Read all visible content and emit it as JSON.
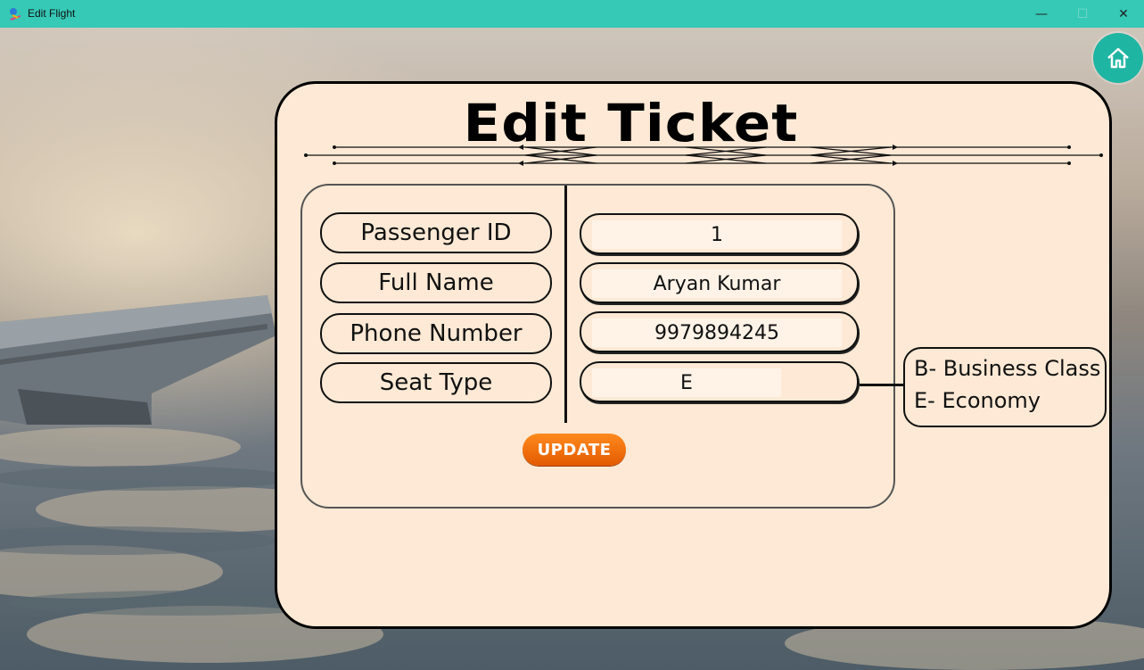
{
  "window": {
    "title": "Edit Flight",
    "minimize_glyph": "—",
    "maximize_glyph": "☐",
    "close_glyph": "✕"
  },
  "home_button": {
    "icon": "home-icon"
  },
  "heading": "Edit Ticket",
  "form": {
    "fields": [
      {
        "label": "Passenger ID",
        "value": "1"
      },
      {
        "label": "Full Name",
        "value": "Aryan Kumar"
      },
      {
        "label": "Phone Number",
        "value": "9979894245"
      },
      {
        "label": "Seat Type",
        "value": "E"
      }
    ],
    "update_label": "UPDATE"
  },
  "legend": {
    "lines": [
      "B- Business Class",
      "E- Economy"
    ]
  },
  "colors": {
    "titlebar": "#35c9b6",
    "card": "#fde9d5",
    "home_button": "#1fb5a3",
    "update_button": "#ec6a0a"
  }
}
